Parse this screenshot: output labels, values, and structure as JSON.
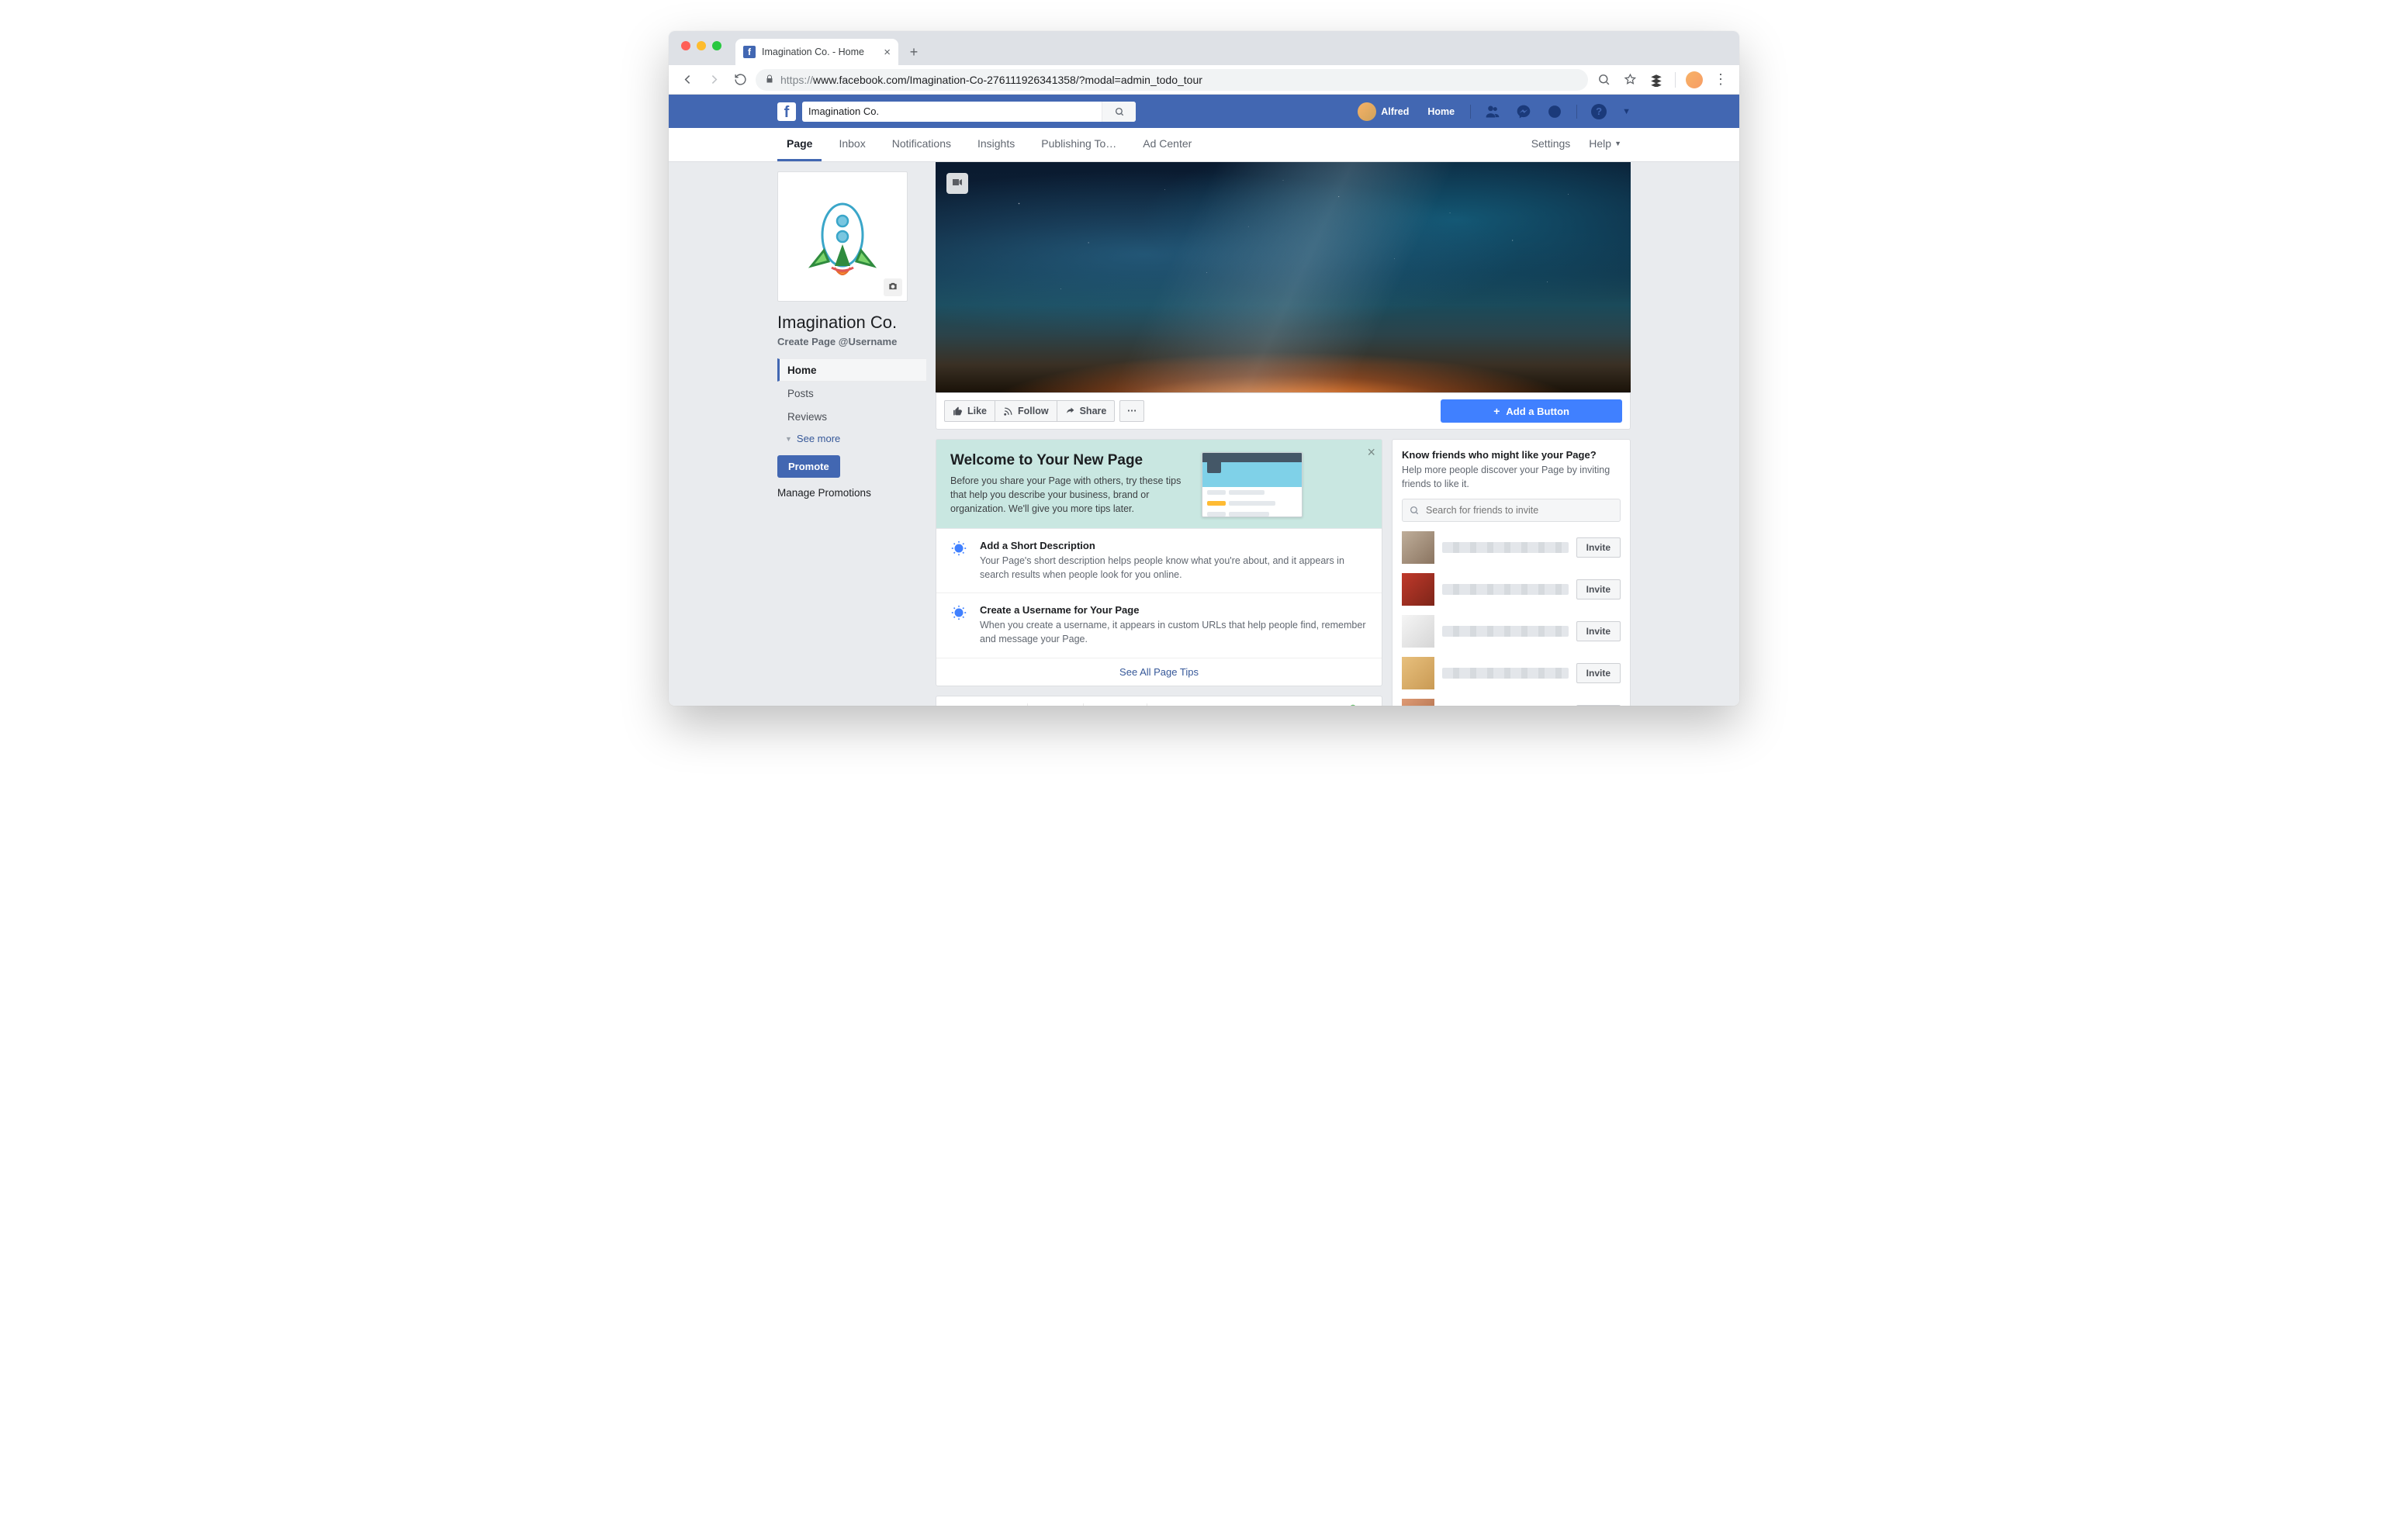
{
  "browser": {
    "tab_title": "Imagination Co. - Home",
    "url_prefix": "https://",
    "url_rest": "www.facebook.com/Imagination-Co-276111926341358/?modal=admin_todo_tour"
  },
  "fb_header": {
    "search_value": "Imagination Co.",
    "profile_name": "Alfred",
    "home_label": "Home"
  },
  "subnav": {
    "tabs": [
      "Page",
      "Inbox",
      "Notifications",
      "Insights",
      "Publishing To…",
      "Ad Center"
    ],
    "right": [
      "Settings",
      "Help"
    ]
  },
  "left": {
    "page_name": "Imagination Co.",
    "create_username": "Create Page @Username",
    "menu": [
      "Home",
      "Posts",
      "Reviews"
    ],
    "see_more": "See more",
    "promote": "Promote",
    "manage_promotions": "Manage Promotions"
  },
  "actions": {
    "like": "Like",
    "follow": "Follow",
    "share": "Share",
    "add_button": "Add a Button"
  },
  "welcome": {
    "title": "Welcome to Your New Page",
    "body": "Before you share your Page with others, try these tips that help you describe your business, brand or organization. We'll give you more tips later."
  },
  "tips": [
    {
      "title": "Add a Short Description",
      "body": "Your Page's short description helps people know what you're about, and it appears in search results when people look for you online."
    },
    {
      "title": "Create a Username for Your Page",
      "body": "When you create a username, it appears in custom URLs that help people find, remember and message your Page."
    }
  ],
  "see_all": "See All Page Tips",
  "composer": {
    "create_post": "Create Post",
    "live": "Live",
    "event": "Event",
    "offer": "Offer"
  },
  "right": {
    "title": "Know friends who might like your Page?",
    "subtitle": "Help more people discover your Page by inviting friends to like it.",
    "search_placeholder": "Search for friends to invite",
    "invite_label": "Invite",
    "friend_count": 5
  }
}
